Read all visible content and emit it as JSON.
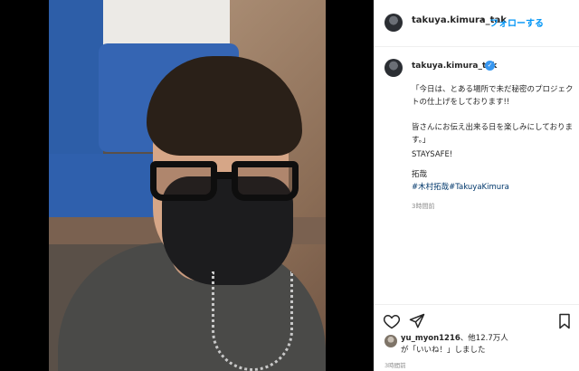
{
  "header": {
    "username": "takuya.kimura_tak",
    "separator": "•",
    "follow_label": "フォローする"
  },
  "caption": {
    "username": "takuya.kimura_tak",
    "verified_mark": "✓",
    "line1": "「今日は、とある場所で未だ秘密のプロジェクトの仕上げをしております!!",
    "line2": "皆さんにお伝え出来る日を楽しみにしております。」",
    "line3": "STAYSAFE!",
    "line4": "拓哉",
    "hashtags": "#木村拓哉#TakuyaKimura",
    "time": "3時間前"
  },
  "likes": {
    "user": "yu_myon1216",
    "others": "、他12.7万人",
    "line2": "が「いいね！」しました",
    "time": "3時間前"
  },
  "icons": {
    "like": "heart-icon",
    "share": "share-icon",
    "save": "bookmark-icon"
  }
}
